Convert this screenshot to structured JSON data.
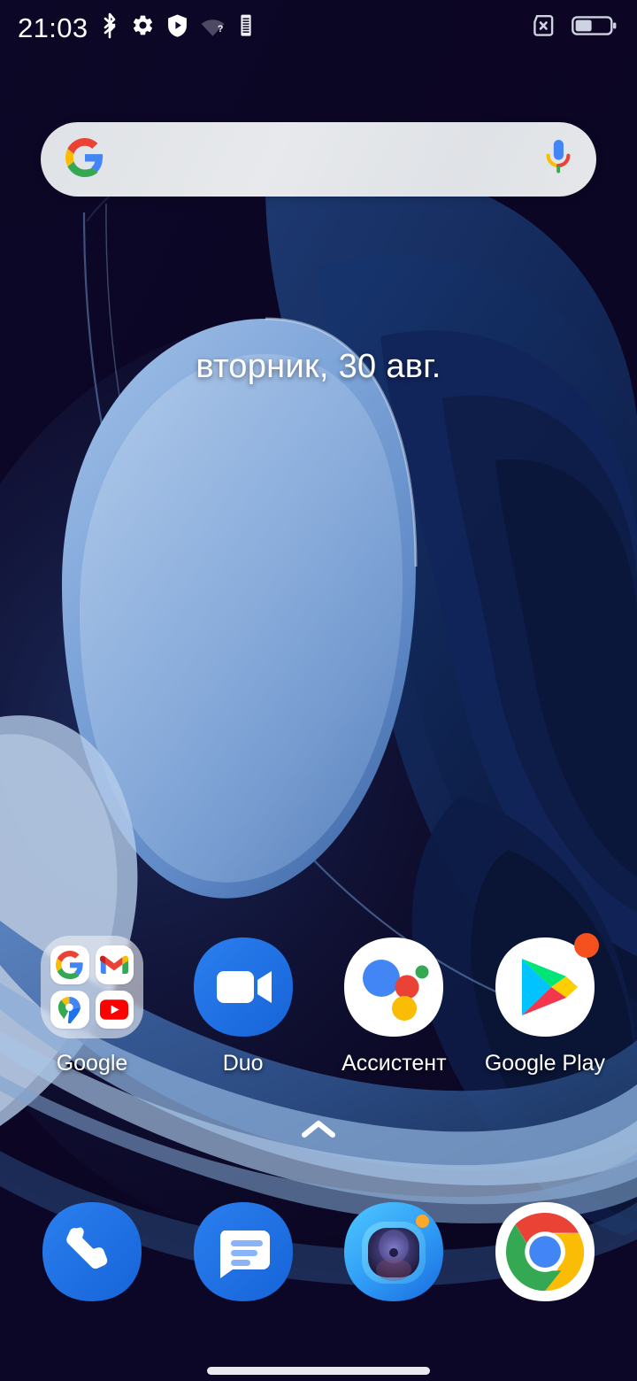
{
  "status_bar": {
    "time": "21:03",
    "left_icons": [
      {
        "name": "bluetooth-icon",
        "label": "Bluetooth"
      },
      {
        "name": "settings-gear-icon",
        "label": "Настройки"
      },
      {
        "name": "play-protect-shield-icon",
        "label": "Play Защита"
      },
      {
        "name": "wifi-no-internet-icon",
        "label": "Wi-Fi без интернета"
      },
      {
        "name": "mobile-data-icon",
        "label": "Мобильные данные"
      }
    ],
    "right_icons": [
      {
        "name": "no-sim-card-icon",
        "label": "Нет SIM-карты"
      },
      {
        "name": "battery-icon",
        "label": "Батарея",
        "level_percent": 45
      }
    ]
  },
  "search_widget": {
    "name": "google-search-bar",
    "placeholder": "",
    "value": "",
    "google_logo": "google-g-icon",
    "mic_icon": "microphone-icon"
  },
  "date_widget": {
    "text": "вторник, 30 авг."
  },
  "app_grid": [
    {
      "label": "Google",
      "icon": "google-folder-icon",
      "type": "folder",
      "contents": [
        "google-g-icon",
        "gmail-icon",
        "maps-icon",
        "youtube-icon"
      ],
      "badge": false
    },
    {
      "label": "Duo",
      "icon": "duo-icon",
      "type": "app",
      "badge": false
    },
    {
      "label": "Ассистент",
      "icon": "google-assistant-icon",
      "type": "app",
      "badge": false
    },
    {
      "label": "Google Play",
      "icon": "google-play-icon",
      "type": "app",
      "badge": true
    }
  ],
  "drawer_handle": {
    "icon": "chevron-up-icon",
    "label": "Открыть меню приложений"
  },
  "dock": [
    {
      "label": "Телефон",
      "icon": "phone-icon",
      "badge": false
    },
    {
      "label": "Сообщения",
      "icon": "messages-icon",
      "badge": false
    },
    {
      "label": "Камера",
      "icon": "camera-icon",
      "badge": true
    },
    {
      "label": "Chrome",
      "icon": "chrome-icon",
      "badge": false
    }
  ],
  "navigation": {
    "home_bar": "gesture-home-bar"
  },
  "colors": {
    "wallpaper_background": "#0c0726",
    "wallpaper_blue_light": "#7fa4d8",
    "wallpaper_blue_mid": "#27518f",
    "wallpaper_blue_dark": "#101a46",
    "search_bar_background": "#e3e5e8",
    "accent_blue": "#1a73e8",
    "badge_orange": "#f4511e",
    "text_white": "#ffffff"
  }
}
